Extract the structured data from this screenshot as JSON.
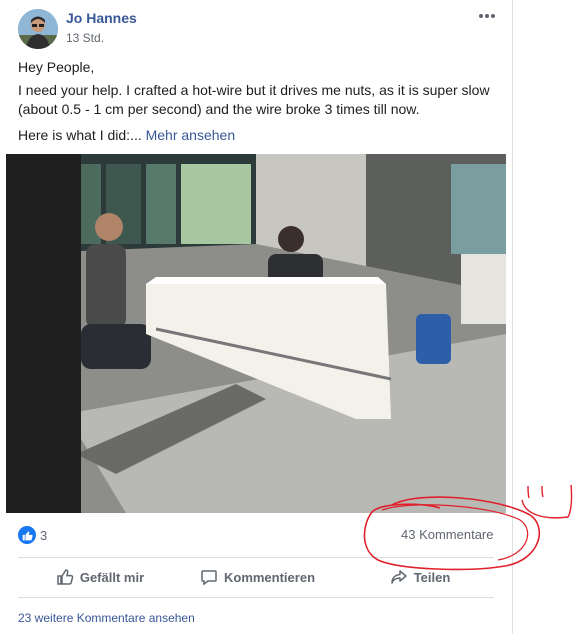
{
  "post": {
    "author": "Jo Hannes",
    "time": "13 Std.",
    "paragraphs": {
      "greeting": "Hey People,",
      "body": "I need your help. I crafted a hot-wire but it drives me nuts, as it is super slow (about 0.5 - 1 cm per second) and the wire broke 3 times till now.",
      "intro": "Here is what I did:... "
    },
    "see_more": "Mehr ansehen",
    "more_icon": "more-options-icon"
  },
  "stats": {
    "reactions_count": "3",
    "comments_count": "43 Kommentare"
  },
  "actions": {
    "like": "Gefällt mir",
    "comment": "Kommentieren",
    "share": "Teilen"
  },
  "footer": {
    "view_more_comments": "23 weitere Kommentare ansehen"
  },
  "colors": {
    "link": "#385898",
    "like_blue": "#1877f2",
    "annotation_red": "#e0202a",
    "muted": "#606770"
  }
}
